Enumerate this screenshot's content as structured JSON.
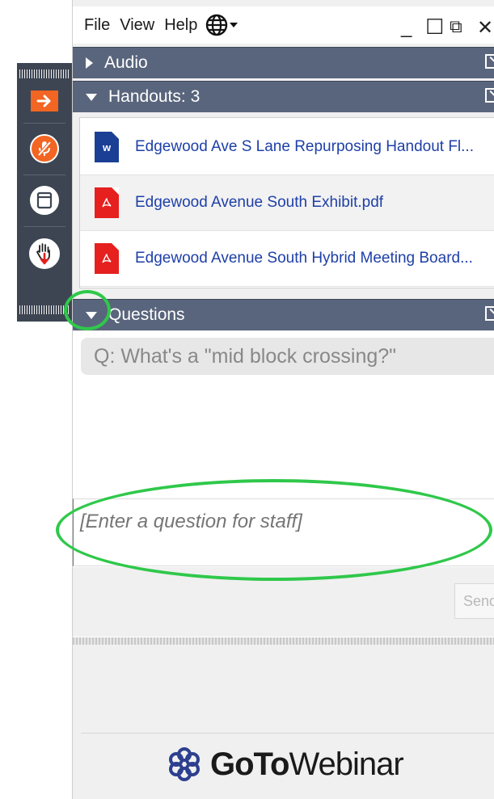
{
  "menubar": {
    "items": [
      "File",
      "View",
      "Help"
    ]
  },
  "window_controls": {
    "minimize": "_",
    "maximize": "☐",
    "popout": "⧉",
    "close": "✕"
  },
  "sections": {
    "audio": {
      "label": "Audio"
    },
    "handouts": {
      "label": "Handouts: 3",
      "files": [
        {
          "name": "Edgewood Ave S Lane Repurposing Handout Fl...",
          "type": "word"
        },
        {
          "name": "Edgewood Avenue South Exhibit.pdf",
          "type": "pdf"
        },
        {
          "name": "Edgewood Avenue South Hybrid Meeting Board...",
          "type": "pdf"
        }
      ]
    },
    "questions": {
      "label": "Questions",
      "items": [
        "Q: What's a \"mid block crossing?\""
      ],
      "input_placeholder": "[Enter a question for staff]",
      "send_label": "Send"
    }
  },
  "brand": {
    "go": "Go",
    "to": "To",
    "product": "Webinar"
  },
  "strip": {
    "buttons": [
      "exit-arrow",
      "microphone-muted",
      "screen-view",
      "raise-hand"
    ]
  },
  "colors": {
    "section_header": "#59657c",
    "strip": "#3d4552",
    "accent_orange": "#f26522",
    "link_blue": "#1e3fa8",
    "annotation": "#2fc84a"
  }
}
